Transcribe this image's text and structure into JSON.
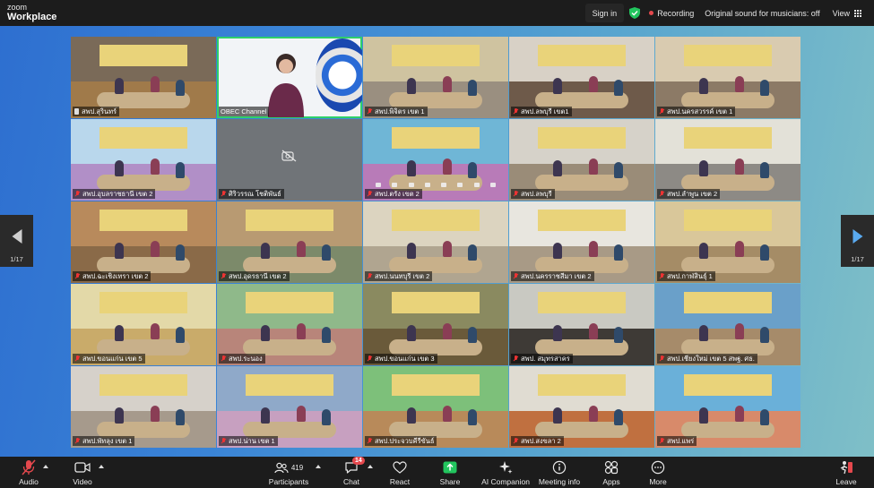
{
  "app": {
    "logo_top": "zoom",
    "logo_bottom": "Workplace"
  },
  "topbar": {
    "signin_label": "Sign in",
    "recording_label": "Recording",
    "sound_label": "Original sound for musicians: off",
    "view_label": "View"
  },
  "tiles": [
    {
      "name": "สพป.สุรินทร์",
      "muted": false,
      "pinned": true,
      "palette": [
        "#7a6a58",
        "#a07a4a"
      ]
    },
    {
      "name": "OBEC Channel",
      "muted": false,
      "pinned": false,
      "palette": [
        "#f2f4f7",
        "#f2f4f7"
      ]
    },
    {
      "name": "สพป.พิจิตร เขต 1",
      "muted": true,
      "pinned": false,
      "palette": [
        "#cfc3a0",
        "#9a8f80"
      ]
    },
    {
      "name": "สพป.ลพบุรี เขต1",
      "muted": true,
      "pinned": false,
      "palette": [
        "#d8d1c6",
        "#6e5a4a"
      ]
    },
    {
      "name": "สพป.นครสวรรค์ เขต 1",
      "muted": true,
      "pinned": false,
      "palette": [
        "#d9cbb0",
        "#8c7a66"
      ]
    },
    {
      "name": "สพป.อุบลราชธานี เขต 2",
      "muted": true,
      "pinned": false,
      "palette": [
        "#b9d7ec",
        "#b18fc7"
      ]
    },
    {
      "name": "ศิริวรรณ โชติพันธ์",
      "muted": true,
      "pinned": false,
      "camera_off": true,
      "palette": [
        "#707478",
        "#707478"
      ]
    },
    {
      "name": "สพป.ตรัง เขต 2",
      "muted": true,
      "pinned": false,
      "palette": [
        "#6fb6d6",
        "#b87bb8"
      ]
    },
    {
      "name": "สพป.ลพบุรี",
      "muted": true,
      "pinned": false,
      "palette": [
        "#d6d2c9",
        "#9a8c78"
      ]
    },
    {
      "name": "สพป.ลำพูน เขต 2",
      "muted": true,
      "pinned": false,
      "palette": [
        "#e3e1d8",
        "#8d8a85"
      ]
    },
    {
      "name": "สพป.ฉะเชิงเทรา เขต 2",
      "muted": true,
      "pinned": false,
      "palette": [
        "#b88a5c",
        "#8a6a48"
      ]
    },
    {
      "name": "สพป.อุดรธานี เขต 2",
      "muted": true,
      "pinned": false,
      "palette": [
        "#b89a72",
        "#7c8a6a"
      ]
    },
    {
      "name": "สพป.นนทบุรี เขต 2",
      "muted": true,
      "pinned": false,
      "palette": [
        "#dcd4c0",
        "#b0a590"
      ]
    },
    {
      "name": "สพป.นครราชสีมา เขต 2",
      "muted": true,
      "pinned": false,
      "palette": [
        "#e8e6df",
        "#a89a86"
      ]
    },
    {
      "name": "สพป.กาฬสินธุ์ 1",
      "muted": true,
      "pinned": false,
      "palette": [
        "#d9c79a",
        "#a58c66"
      ]
    },
    {
      "name": "สพป.ขอนแก่น เขต 5",
      "muted": true,
      "pinned": false,
      "palette": [
        "#e3d9a8",
        "#c9ab6a"
      ]
    },
    {
      "name": "สพป.ระนอง",
      "muted": true,
      "pinned": false,
      "palette": [
        "#8fb98a",
        "#b8857a"
      ]
    },
    {
      "name": "สพป.ขอนแก่น เขต 3",
      "muted": true,
      "pinned": false,
      "palette": [
        "#8a8a60",
        "#6a5a3a"
      ]
    },
    {
      "name": "สพป. สมุทรสาคร",
      "muted": true,
      "pinned": false,
      "palette": [
        "#c9c9c2",
        "#3e3a36"
      ]
    },
    {
      "name": "สพป.เชียงใหม่ เขต 5 สพฐ. ศธ.",
      "muted": true,
      "pinned": false,
      "palette": [
        "#6aa0c9",
        "#a68b6a"
      ]
    },
    {
      "name": "สพป.พัทลุง เขต 1",
      "muted": true,
      "pinned": false,
      "palette": [
        "#d6d1ca",
        "#a69a8c"
      ]
    },
    {
      "name": "สพป.น่าน เขต 1",
      "muted": true,
      "pinned": false,
      "palette": [
        "#8fa9c9",
        "#c7a0c0"
      ]
    },
    {
      "name": "สพป.ประจวบคีรีขันธ์",
      "muted": true,
      "pinned": false,
      "palette": [
        "#7dc07a",
        "#b88a5a"
      ]
    },
    {
      "name": "สพป.สงขลา 2",
      "muted": true,
      "pinned": false,
      "palette": [
        "#e0dcd2",
        "#c07040"
      ]
    },
    {
      "name": "สพป.แพร่",
      "muted": true,
      "pinned": false,
      "palette": [
        "#6ab0d9",
        "#d88a6a"
      ]
    }
  ],
  "pagination": {
    "left": "1/17",
    "right": "1/17"
  },
  "toolbar": {
    "audio": "Audio",
    "video": "Video",
    "participants": "Participants",
    "participants_count": "419",
    "chat": "Chat",
    "chat_badge": "14",
    "react": "React",
    "share": "Share",
    "ai_companion": "AI Companion",
    "meeting_info": "Meeting info",
    "apps": "Apps",
    "more": "More",
    "leave": "Leave"
  },
  "colors": {
    "share_green": "#22c55e",
    "leave_red": "#e5484d",
    "active_speaker": "#2fd06a",
    "recording_dot": "#e5484d"
  }
}
